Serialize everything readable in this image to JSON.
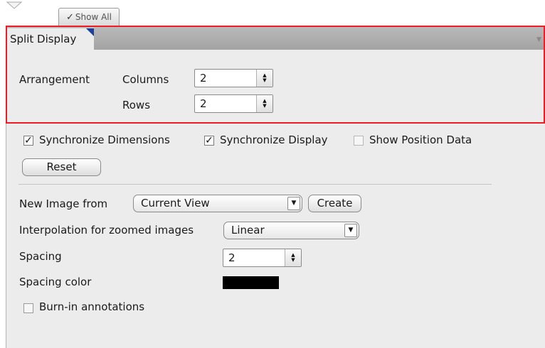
{
  "toolbar": {
    "show_all_label": "Show All",
    "show_all_checked": "✓"
  },
  "split_display": {
    "tab_label": "Split Display",
    "arrangement_label": "Arrangement",
    "columns_label": "Columns",
    "columns_value": "2",
    "rows_label": "Rows",
    "rows_value": "2"
  },
  "options": {
    "sync_dimensions_label": "Synchronize Dimensions",
    "sync_dimensions_checked": "✓",
    "sync_display_label": "Synchronize Display",
    "sync_display_checked": "✓",
    "show_position_label": "Show Position Data",
    "reset_label": "Reset"
  },
  "image": {
    "new_image_label": "New Image from",
    "new_image_value": "Current View",
    "create_label": "Create",
    "interpolation_label": "Interpolation for zoomed images",
    "interpolation_value": "Linear",
    "spacing_label": "Spacing",
    "spacing_value": "2",
    "spacing_color_label": "Spacing color",
    "spacing_color": "#000000",
    "burn_in_label": "Burn-in annotations"
  },
  "colors": {
    "highlight_frame": "#ee1c24",
    "tab_corner_accent": "#1f3f99"
  }
}
